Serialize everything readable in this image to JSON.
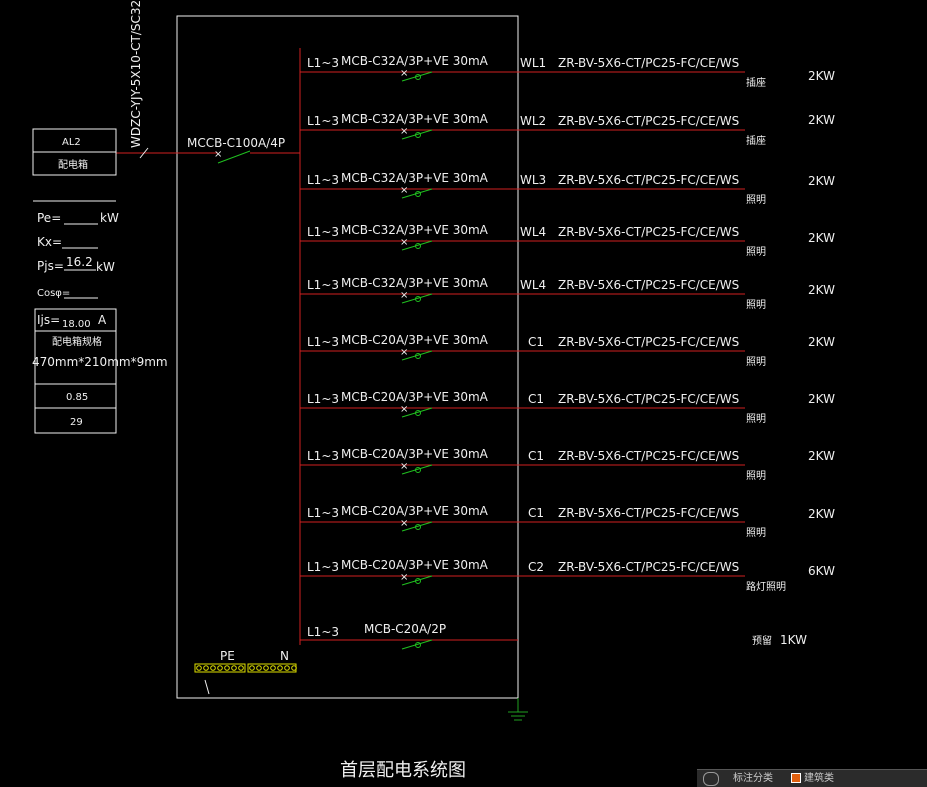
{
  "colors": {
    "background": "#000000",
    "line_red": "#d02020",
    "line_white": "#f0f0f0",
    "breaker_green": "#20c020",
    "ground_green": "#20a020"
  },
  "incoming": {
    "cable": "WDZC-YJY-5X10-CT/SC32",
    "breaker": "MCCB-C100A/4P"
  },
  "panel": {
    "id": "AL2",
    "name": "配电箱"
  },
  "calc": {
    "pe_label": "Pe=",
    "pe_unit": "kW",
    "kx_label": "Kx=",
    "pjs_label": "Pjs=",
    "pjs_value": "16.2",
    "pjs_unit": "kW",
    "cos_label": "Cosφ=",
    "ijs_label": "Ijs=",
    "ijs_value": "18.00",
    "ijs_unit": "A",
    "size_label": "配电箱规格",
    "size_value": "470mm*210mm*9mm",
    "row3": "0.85",
    "row4": "29"
  },
  "circuits": [
    {
      "phase": "L1~3",
      "breaker": "MCB-C32A/3P+VE 30mA",
      "id": "WL1",
      "cable": "ZR-BV-5X6-CT/PC25-FC/CE/WS",
      "use": "插座",
      "power": "2KW"
    },
    {
      "phase": "L1~3",
      "breaker": "MCB-C32A/3P+VE 30mA",
      "id": "WL2",
      "cable": "ZR-BV-5X6-CT/PC25-FC/CE/WS",
      "use": "插座",
      "power": "2KW"
    },
    {
      "phase": "L1~3",
      "breaker": "MCB-C32A/3P+VE 30mA",
      "id": "WL3",
      "cable": "ZR-BV-5X6-CT/PC25-FC/CE/WS",
      "use": "照明",
      "power": "2KW"
    },
    {
      "phase": "L1~3",
      "breaker": "MCB-C32A/3P+VE 30mA",
      "id": "WL4",
      "cable": "ZR-BV-5X6-CT/PC25-FC/CE/WS",
      "use": "照明",
      "power": "2KW"
    },
    {
      "phase": "L1~3",
      "breaker": "MCB-C32A/3P+VE 30mA",
      "id": "WL4",
      "cable": "ZR-BV-5X6-CT/PC25-FC/CE/WS",
      "use": "照明",
      "power": "2KW"
    },
    {
      "phase": "L1~3",
      "breaker": "MCB-C20A/3P+VE 30mA",
      "id": "C1",
      "cable": "ZR-BV-5X6-CT/PC25-FC/CE/WS",
      "use": "照明",
      "power": "2KW"
    },
    {
      "phase": "L1~3",
      "breaker": "MCB-C20A/3P+VE 30mA",
      "id": "C1",
      "cable": "ZR-BV-5X6-CT/PC25-FC/CE/WS",
      "use": "照明",
      "power": "2KW"
    },
    {
      "phase": "L1~3",
      "breaker": "MCB-C20A/3P+VE 30mA",
      "id": "C1",
      "cable": "ZR-BV-5X6-CT/PC25-FC/CE/WS",
      "use": "照明",
      "power": "2KW"
    },
    {
      "phase": "L1~3",
      "breaker": "MCB-C20A/3P+VE 30mA",
      "id": "C1",
      "cable": "ZR-BV-5X6-CT/PC25-FC/CE/WS",
      "use": "照明",
      "power": "2KW"
    },
    {
      "phase": "L1~3",
      "breaker": "MCB-C20A/3P+VE 30mA",
      "id": "C2",
      "cable": "ZR-BV-5X6-CT/PC25-FC/CE/WS",
      "use": "路灯照明",
      "power": "6KW"
    }
  ],
  "spare": {
    "phase": "L1~3",
    "breaker": "MCB-C20A/2P",
    "use": "预留",
    "power": "1KW"
  },
  "bus": {
    "pe": "PE",
    "n": "N"
  },
  "title": "首层配电系统图",
  "toolbar": {
    "item1": "标注分类",
    "item2": "建筑类"
  }
}
